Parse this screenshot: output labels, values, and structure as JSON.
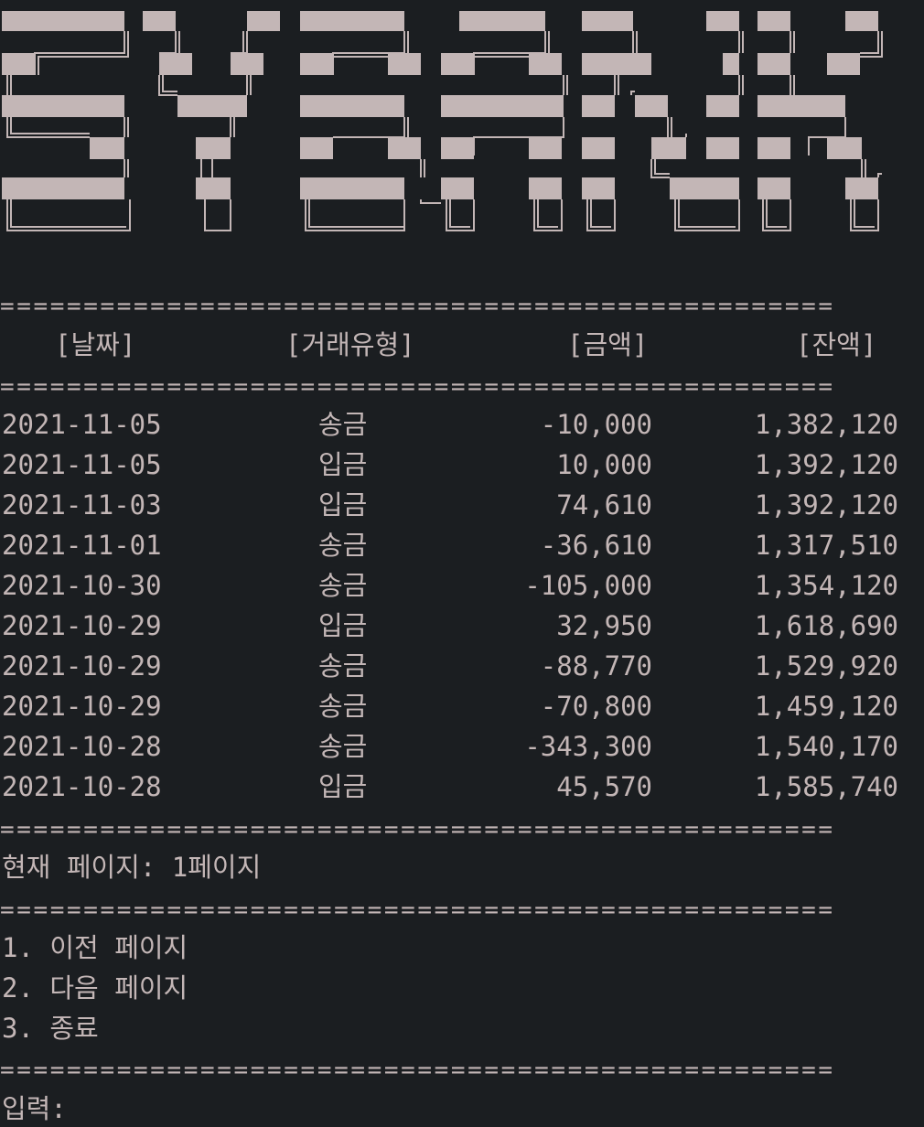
{
  "banner": {
    "icon": "ascii-art-bank-logo"
  },
  "table": {
    "headers": {
      "date": "[날짜]",
      "type": "[거래유형]",
      "amount": "[금액]",
      "balance": "[잔액]"
    },
    "rows": [
      {
        "date": "2021-11-05",
        "type": "송금",
        "amount": "-10,000",
        "balance": "1,382,120"
      },
      {
        "date": "2021-11-05",
        "type": "입금",
        "amount": "10,000",
        "balance": "1,392,120"
      },
      {
        "date": "2021-11-03",
        "type": "입금",
        "amount": "74,610",
        "balance": "1,392,120"
      },
      {
        "date": "2021-11-01",
        "type": "송금",
        "amount": "-36,610",
        "balance": "1,317,510"
      },
      {
        "date": "2021-10-30",
        "type": "송금",
        "amount": "-105,000",
        "balance": "1,354,120"
      },
      {
        "date": "2021-10-29",
        "type": "입금",
        "amount": "32,950",
        "balance": "1,618,690"
      },
      {
        "date": "2021-10-29",
        "type": "송금",
        "amount": "-88,770",
        "balance": "1,529,920"
      },
      {
        "date": "2021-10-29",
        "type": "송금",
        "amount": "-70,800",
        "balance": "1,459,120"
      },
      {
        "date": "2021-10-28",
        "type": "송금",
        "amount": "-343,300",
        "balance": "1,540,170"
      },
      {
        "date": "2021-10-28",
        "type": "입금",
        "amount": "45,570",
        "balance": "1,585,740"
      }
    ]
  },
  "separator": "==================================================",
  "page_status": "현재 페이지: 1페이지",
  "menu": [
    {
      "label": "1. 이전 페이지"
    },
    {
      "label": "2. 다음 페이지"
    },
    {
      "label": "3. 종료"
    }
  ],
  "prompt": "입력:",
  "colors": {
    "background": "#1b1e21",
    "text": "#c3b6b6"
  }
}
